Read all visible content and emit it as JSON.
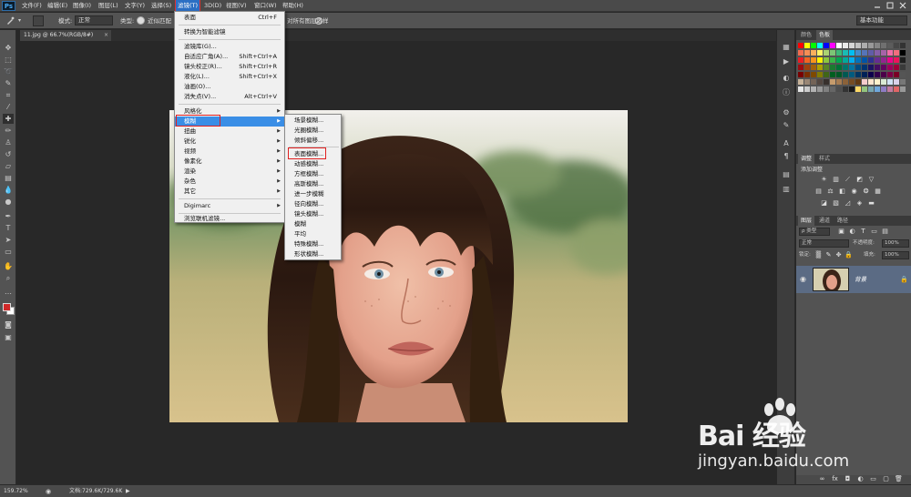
{
  "app": {
    "logo": "Ps"
  },
  "menubar": {
    "items": [
      {
        "label": "文件(F)"
      },
      {
        "label": "编辑(E)"
      },
      {
        "label": "图像(I)"
      },
      {
        "label": "图层(L)"
      },
      {
        "label": "文字(Y)"
      },
      {
        "label": "选择(S)"
      },
      {
        "label": "滤镜(T)"
      },
      {
        "label": "3D(D)"
      },
      {
        "label": "视图(V)"
      },
      {
        "label": "窗口(W)"
      },
      {
        "label": "帮助(H)"
      }
    ],
    "active": "滤镜(T)"
  },
  "options_bar": {
    "mode_label": "模式:",
    "mode_value": "正常",
    "type_label": "类型:",
    "proximity_label": "近似匹配",
    "sample_all_label": "对所有图层取样",
    "workspace": "基本功能"
  },
  "document_tab": {
    "title": "11.jpg @ 66.7%(RGB/8#)",
    "close": "×"
  },
  "filter_menu": {
    "items": [
      {
        "label": "表面",
        "shortcut": "Ctrl+F"
      },
      {
        "label": "转换为智能滤镜",
        "shortcut": ""
      },
      {
        "label": "滤镜库(G)...",
        "shortcut": ""
      },
      {
        "label": "自适应广角(A)...",
        "shortcut": "Shift+Ctrl+A"
      },
      {
        "label": "镜头校正(R)...",
        "shortcut": "Shift+Ctrl+R"
      },
      {
        "label": "液化(L)...",
        "shortcut": "Shift+Ctrl+X"
      },
      {
        "label": "油画(O)...",
        "shortcut": ""
      },
      {
        "label": "消失点(V)...",
        "shortcut": "Alt+Ctrl+V"
      },
      {
        "label": "风格化",
        "shortcut": ""
      },
      {
        "label": "模糊",
        "shortcut": ""
      },
      {
        "label": "扭曲",
        "shortcut": ""
      },
      {
        "label": "锐化",
        "shortcut": ""
      },
      {
        "label": "视频",
        "shortcut": ""
      },
      {
        "label": "像素化",
        "shortcut": ""
      },
      {
        "label": "渲染",
        "shortcut": ""
      },
      {
        "label": "杂色",
        "shortcut": ""
      },
      {
        "label": "其它",
        "shortcut": ""
      },
      {
        "label": "Digimarc",
        "shortcut": ""
      },
      {
        "label": "浏览联机滤镜...",
        "shortcut": ""
      }
    ]
  },
  "blur_submenu": {
    "items": [
      {
        "label": "场景模糊..."
      },
      {
        "label": "光圈模糊..."
      },
      {
        "label": "倾斜偏移..."
      },
      {
        "label": "表面模糊..."
      },
      {
        "label": "动感模糊..."
      },
      {
        "label": "方框模糊..."
      },
      {
        "label": "高斯模糊..."
      },
      {
        "label": "进一步模糊"
      },
      {
        "label": "径向模糊..."
      },
      {
        "label": "镜头模糊..."
      },
      {
        "label": "模糊"
      },
      {
        "label": "平均"
      },
      {
        "label": "特殊模糊..."
      },
      {
        "label": "形状模糊..."
      }
    ],
    "highlighted": "表面模糊..."
  },
  "panels": {
    "color_tabs": [
      {
        "label": "颜色"
      },
      {
        "label": "色板"
      }
    ],
    "adjust_tabs": [
      {
        "label": "调整"
      },
      {
        "label": "样式"
      }
    ],
    "adjust_title": "添加调整",
    "layer_tabs": [
      {
        "label": "图层"
      },
      {
        "label": "通道"
      },
      {
        "label": "路径"
      }
    ],
    "kind_label": "ρ 类型",
    "blend_mode": "正常",
    "opacity_label": "不透明度:",
    "opacity_value": "100%",
    "lock_label": "锁定:",
    "fill_label": "填充:",
    "fill_value": "100%",
    "layer_name": "背景"
  },
  "statusbar": {
    "zoom": "159.72%",
    "doc_info": "文档:729.6K/729.6K"
  },
  "watermark": {
    "brand": "Bai 经验",
    "url": "jingyan.baidu.com"
  },
  "colors": {
    "ui_dark": "#282828",
    "ui_panel": "#535353",
    "menu_bg": "#f0f0f0",
    "highlight": "#3a8ee6",
    "annotation_red": "#e02020"
  }
}
